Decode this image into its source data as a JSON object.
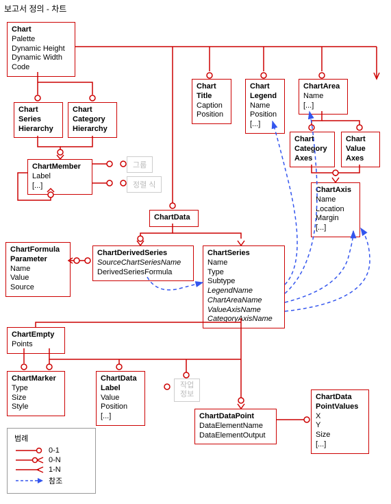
{
  "title": "보고서 정의 - 차트",
  "boxes": {
    "chart": {
      "header": "Chart",
      "lines": [
        "Palette",
        "Dynamic Height",
        "Dynamic Width",
        "Code"
      ]
    },
    "seriesHierarchy": {
      "header1": "Chart",
      "header2": "Series",
      "header3": "Hierarchy"
    },
    "categoryHierarchy": {
      "header1": "Chart",
      "header2": "Category",
      "header3": "Hierarchy"
    },
    "chartMember": {
      "header": "ChartMember",
      "l1": "Label",
      "l2": "[...]"
    },
    "greyGroup": "그룹",
    "greySort": "정렬 식",
    "chartTitle": {
      "header1": "Chart",
      "header2": "Title",
      "l1": "Caption",
      "l2": "Position"
    },
    "chartLegend": {
      "header1": "Chart",
      "header2": "Legend",
      "l1": "Name",
      "l2": "Position",
      "l3": "[...]"
    },
    "chartArea": {
      "header": "ChartArea",
      "l1": "Name",
      "l2": "[...]"
    },
    "catAxes": {
      "header1": "Chart",
      "header2": "Category",
      "header3": "Axes"
    },
    "valAxes": {
      "header1": "Chart",
      "header2": "Value",
      "header3": "Axes"
    },
    "chartAxis": {
      "header": "ChartAxis",
      "l1": "Name",
      "l2": "Location",
      "l3": "Margin",
      "l4": "[...]"
    },
    "chartData": {
      "header": "ChartData"
    },
    "formulaParam": {
      "header": "ChartFormula",
      "header2": "Parameter",
      "l1": "Name",
      "l2": "Value",
      "l3": "Source"
    },
    "derived": {
      "header": "ChartDerivedSeries",
      "l1": "SourceChartSeriesName",
      "l2": "DerivedSeriesFormula"
    },
    "series": {
      "header": "ChartSeries",
      "l1": "Name",
      "l2": "Type",
      "l3": "Subtype",
      "l4": "LegendName",
      "l5": "ChartAreaName",
      "l6": "ValueAxisName",
      "l7": "CategoryAxisName"
    },
    "empty": {
      "header": "ChartEmpty",
      "l1": "Points"
    },
    "marker": {
      "header": "ChartMarker",
      "l1": "Type",
      "l2": "Size",
      "l3": "Style"
    },
    "dataLabel": {
      "header1": "ChartData",
      "header2": "Label",
      "l1": "Value",
      "l2": "Position",
      "l3": "[...]"
    },
    "greyWork": "작업",
    "greyInfo": "정보",
    "dataPoint": {
      "header": "ChartDataPoint",
      "l1": "DataElementName",
      "l2": "DataElementOutput"
    },
    "pointValues": {
      "header1": "ChartData",
      "header2": "PointValues",
      "l1": "X",
      "l2": "Y",
      "l3": "Size",
      "l4": "[...]"
    }
  },
  "legend": {
    "title": "범례",
    "r01": "0-1",
    "r0N": "0-N",
    "r1N": "1-N",
    "ref": "참조"
  }
}
